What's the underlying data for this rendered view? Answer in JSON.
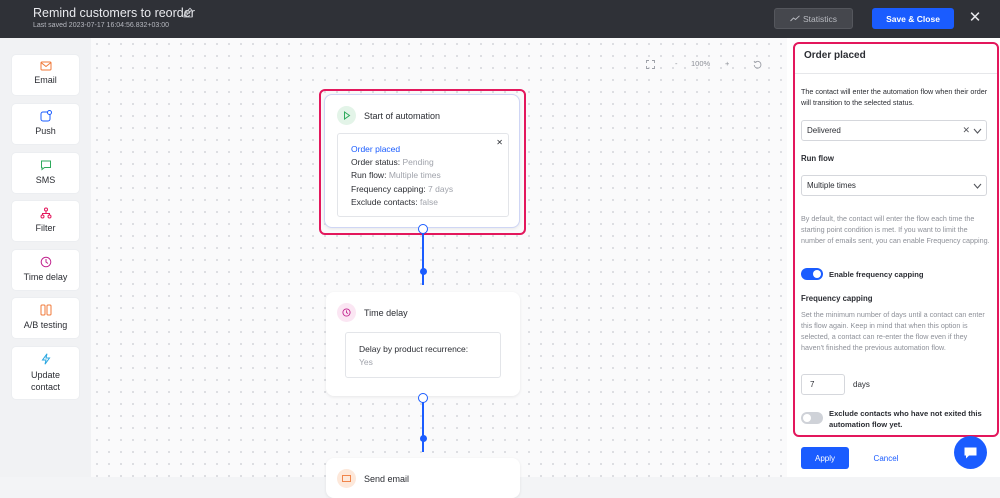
{
  "topbar": {
    "title": "Remind customers to reorder",
    "last_saved": "Last saved 2023-07-17 16:04:56.832+03:00",
    "statistics_label": "Statistics",
    "save_close_label": "Save & Close",
    "close_icon": "close-icon",
    "edit_icon": "pencil-icon"
  },
  "sidebar": {
    "items": [
      {
        "label": "Email",
        "icon": "envelope-icon"
      },
      {
        "label": "Push",
        "icon": "push-icon"
      },
      {
        "label": "SMS",
        "icon": "chat-icon"
      },
      {
        "label": "Filter",
        "icon": "filter-icon"
      },
      {
        "label": "Time delay",
        "icon": "clock-icon"
      },
      {
        "label": "A/B testing",
        "icon": "ab-test-icon"
      },
      {
        "label": "Update contact",
        "icon": "lightning-icon"
      }
    ]
  },
  "canvas": {
    "zoom_level": "100%",
    "zoom_out": "-",
    "zoom_in": "+",
    "start_node": {
      "title": "Start of automation",
      "detail_title": "Order placed",
      "rows": [
        {
          "key": "Order status:",
          "value": "Pending"
        },
        {
          "key": "Run flow:",
          "value": "Multiple times"
        },
        {
          "key": "Frequency capping:",
          "value": "7 days"
        },
        {
          "key": "Exclude contacts:",
          "value": "false"
        }
      ]
    },
    "delay_node": {
      "title": "Time delay",
      "detail_key": "Delay by product recurrence:",
      "detail_value": "Yes"
    },
    "next_node_title": "Send email"
  },
  "panel": {
    "title": "Order placed",
    "intro": "The contact will enter the automation flow when their order will transition to the selected status.",
    "status_value": "Delivered",
    "run_flow_label": "Run flow",
    "run_flow_value": "Multiple times",
    "default_note": "By default, the contact will enter the flow each time the starting point condition is met. If you want to limit the number of emails sent, you can enable Frequency capping.",
    "enable_capping_label": "Enable frequency capping",
    "enable_capping_on": true,
    "capping_label": "Frequency capping",
    "capping_note": "Set the minimum number of days until a contact can enter this flow again. Keep in mind that when this option is selected, a contact can re-enter the flow even if they haven't finished the previous automation flow.",
    "days_value": "7",
    "days_label": "days",
    "exclude_label": "Exclude contacts who have not exited this automation flow yet.",
    "exclude_on": false,
    "apply_label": "Apply",
    "cancel_label": "Cancel"
  },
  "colors": {
    "accent": "#1a5cff",
    "highlight": "#e3175c",
    "topbar": "#2f3137"
  }
}
